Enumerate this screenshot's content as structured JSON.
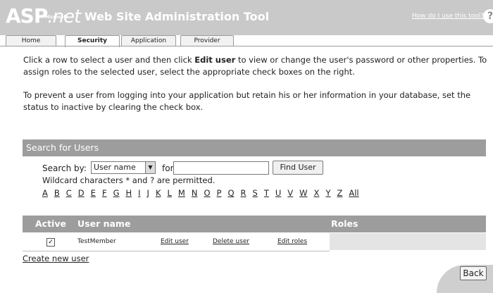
{
  "header": {
    "logo_main": "ASP",
    "logo_net": ".net",
    "logo_ms": "Microsoft",
    "title": "Web Site Administration Tool",
    "help_link": "How do I use this tool?",
    "help_icon": "?"
  },
  "tabs": [
    {
      "label": "Home"
    },
    {
      "label": "Security"
    },
    {
      "label": "Application"
    },
    {
      "label": "Provider"
    }
  ],
  "intro": {
    "p1_a": "Click a row to select a user and then click ",
    "p1_bold": "Edit user",
    "p1_b": " to view or change the user's password or other properties. To assign roles to the selected user, select the appropriate check boxes on the right.",
    "p2": "To prevent a user from logging into your application but retain his or her information in your database, set the status to inactive by clearing the check box."
  },
  "search": {
    "section_title": "Search for Users",
    "search_by_label": "Search by:",
    "search_by_value": "User name",
    "for_label": "for:",
    "for_value": "",
    "find_button": "Find User",
    "wildcard_note": "Wildcard characters * and ? are permitted.",
    "letters": [
      "A",
      "B",
      "C",
      "D",
      "E",
      "F",
      "G",
      "H",
      "I",
      "J",
      "K",
      "L",
      "M",
      "N",
      "O",
      "P",
      "Q",
      "R",
      "S",
      "T",
      "U",
      "V",
      "W",
      "X",
      "Y",
      "Z",
      "All"
    ]
  },
  "users": {
    "col_active": "Active",
    "col_username": "User name",
    "col_roles": "Roles",
    "rows": [
      {
        "active": true,
        "username": "TestMember",
        "edit": "Edit user",
        "delete": "Delete user",
        "roles": "Edit roles"
      }
    ]
  },
  "footer": {
    "create_link": "Create new user",
    "back_button": "Back"
  }
}
